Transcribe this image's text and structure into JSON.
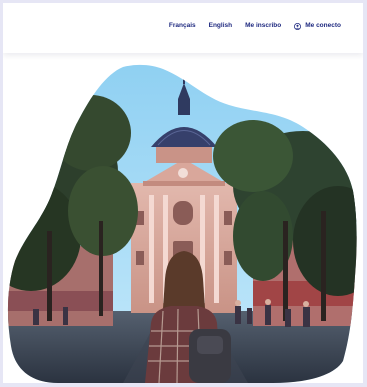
{
  "nav": {
    "links": [
      {
        "label": "Français"
      },
      {
        "label": "English"
      },
      {
        "label": "Me inscribo"
      },
      {
        "label": "Me conecto",
        "icon": "user-icon"
      }
    ]
  },
  "hero": {
    "image": "blob-shaped photo of a domed university building at the end of a tree-lined street, woman in plaid shirt with backpack in foreground"
  },
  "colors": {
    "nav_text": "#1f2a80",
    "frame": "#e6e6f5",
    "sky": "#9cd6f4"
  }
}
